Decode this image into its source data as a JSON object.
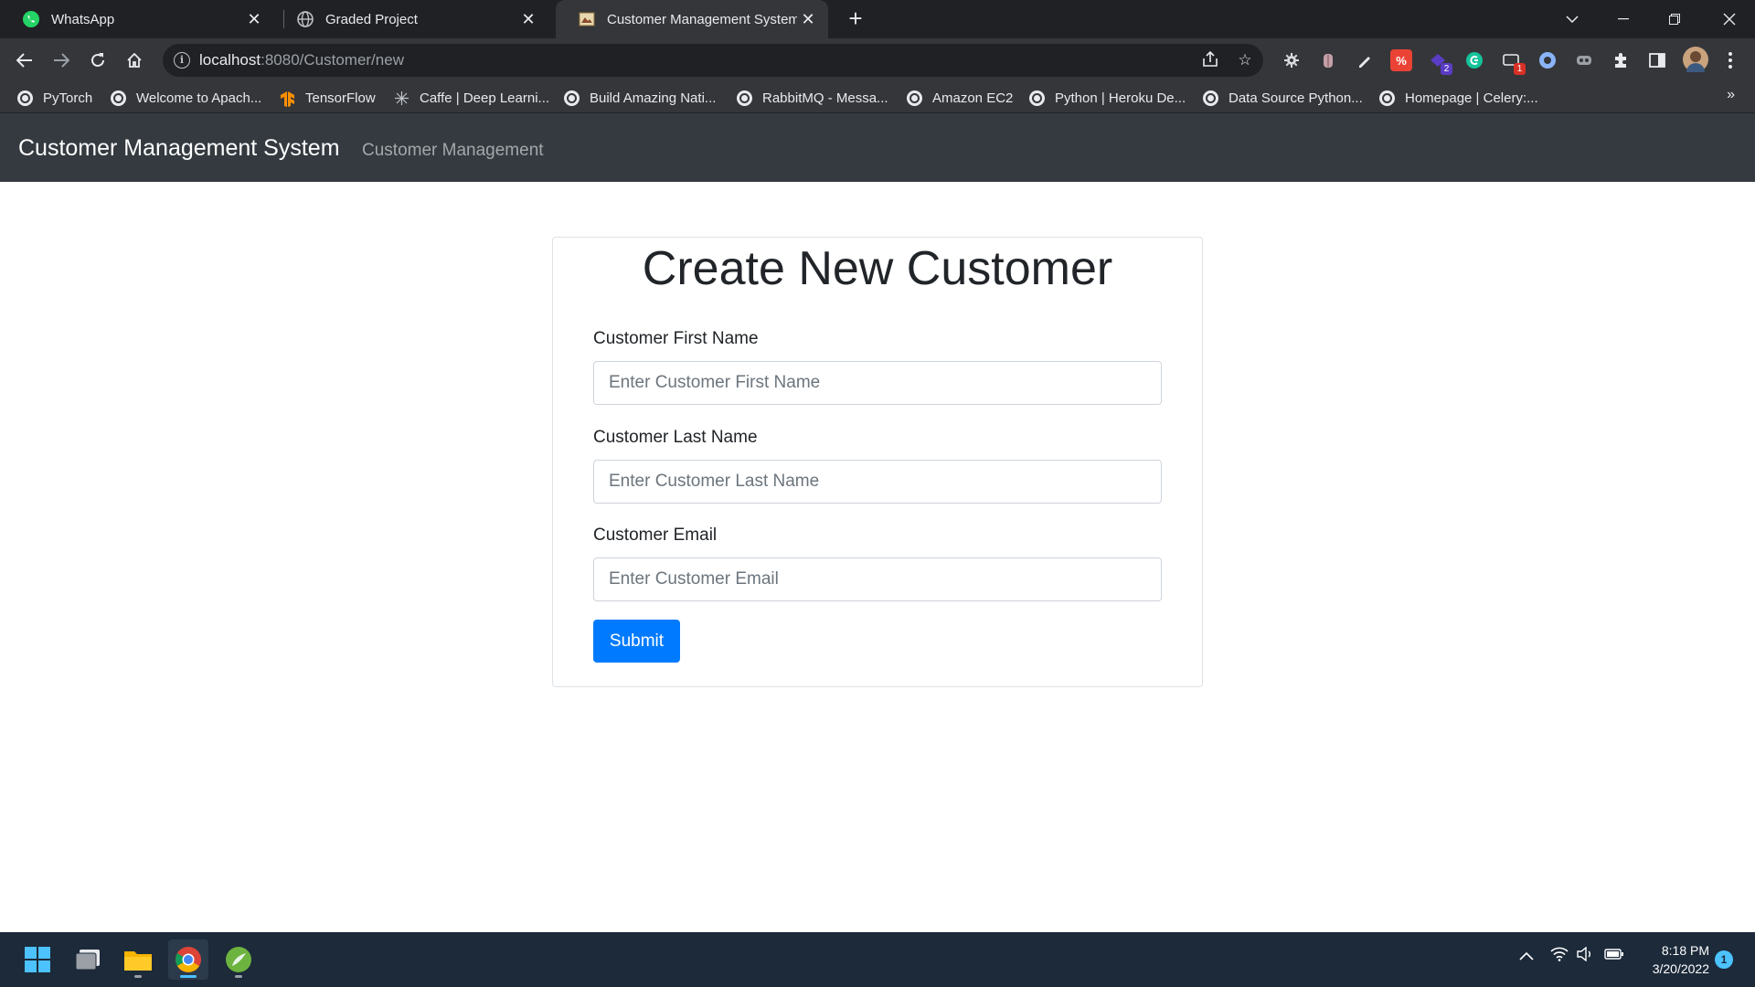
{
  "browser": {
    "tabs": [
      {
        "title": "WhatsApp",
        "icon": "whatsapp-icon",
        "active": false
      },
      {
        "title": "Graded Project",
        "icon": "globe-icon",
        "active": false
      },
      {
        "title": "Customer Management System",
        "icon": "page-favicon-icon",
        "active": true
      }
    ],
    "new_tab_label": "+",
    "url_host": "localhost",
    "url_rest": ":8080/Customer/new",
    "bookmarks": [
      "PyTorch",
      "Welcome to Apach...",
      "TensorFlow",
      "Caffe | Deep Learni...",
      "Build Amazing Nati...",
      "RabbitMQ - Messa...",
      "Amazon EC2",
      "Python | Heroku De...",
      "Data Source Python...",
      "Homepage | Celery:..."
    ],
    "bookmarks_more": "»",
    "extension_badges": {
      "ext5": "2",
      "ext7": "1"
    }
  },
  "app": {
    "brand": "Customer Management System",
    "nav_link": "Customer Management"
  },
  "form": {
    "title": "Create New Customer",
    "first_name_label": "Customer First Name",
    "first_name_placeholder": "Enter Customer First Name",
    "last_name_label": "Customer Last Name",
    "last_name_placeholder": "Enter Customer Last Name",
    "email_label": "Customer Email",
    "email_placeholder": "Enter Customer Email",
    "submit_label": "Submit"
  },
  "taskbar": {
    "time": "8:18 PM",
    "date": "3/20/2022",
    "notification_count": "1"
  },
  "colors": {
    "navbar": "#343a40",
    "primary": "#007bff",
    "taskbar": "#1c2a3a"
  }
}
